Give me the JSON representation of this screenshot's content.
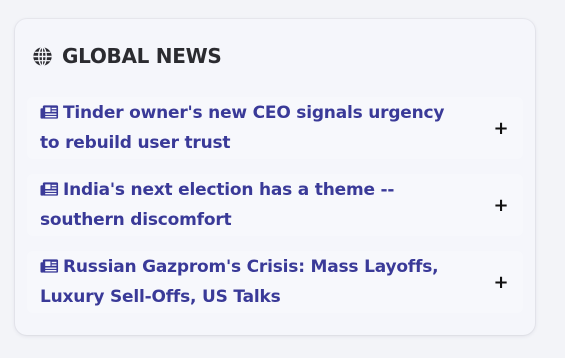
{
  "widget": {
    "title": "GLOBAL NEWS",
    "title_icon": "globe-icon",
    "title_color": "#2b2b30",
    "link_color": "#3a3a98"
  },
  "news": {
    "items": [
      {
        "icon": "newspaper-icon",
        "headline": "Tinder owner's new CEO signals urgency to rebuild user trust",
        "action": "+"
      },
      {
        "icon": "newspaper-icon",
        "headline": "India's next election has a theme -- southern discomfort",
        "action": "+"
      },
      {
        "icon": "newspaper-icon",
        "headline": "Russian Gazprom's Crisis: Mass Layoffs, Luxury Sell-Offs, US Talks",
        "action": "+"
      }
    ]
  }
}
